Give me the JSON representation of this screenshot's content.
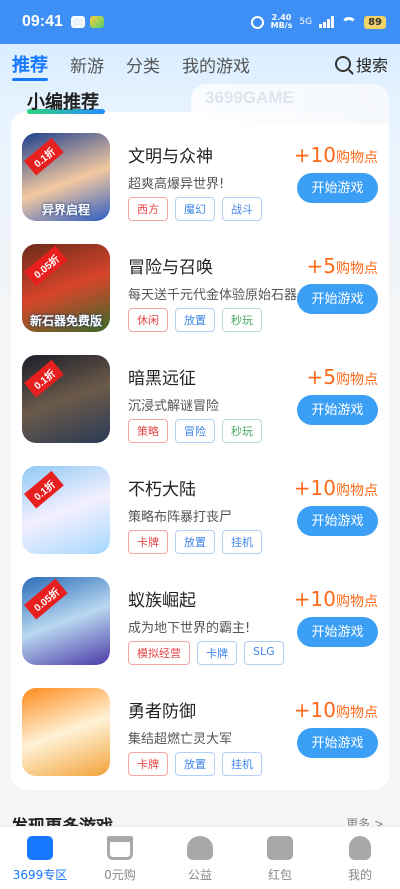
{
  "status": {
    "time": "09:41",
    "speed_top": "2.40",
    "speed_bottom": "MB/s",
    "network": "5G",
    "battery": "89"
  },
  "tabs": [
    {
      "label": "推荐",
      "active": true
    },
    {
      "label": "新游",
      "active": false
    },
    {
      "label": "分类",
      "active": false
    },
    {
      "label": "我的游戏",
      "active": false
    }
  ],
  "search_label": "搜索",
  "section": {
    "title": "小编推荐",
    "watermark": "3699GAME"
  },
  "games": [
    {
      "name": "文明与众神",
      "desc": "超爽高爆异世界!",
      "discount": "0.1折",
      "banner": "异界启程",
      "tags": [
        {
          "t": "西方",
          "c": "red"
        },
        {
          "t": "魔幻",
          "c": "blue"
        },
        {
          "t": "战斗",
          "c": "blue"
        }
      ],
      "points": "+10",
      "points_unit": "购物点",
      "button": "开始游戏"
    },
    {
      "name": "冒险与召唤",
      "desc": "每天送千元代金体验原始石器",
      "discount": "0.05折",
      "banner": "新石器免费版",
      "tags": [
        {
          "t": "休闲",
          "c": "red"
        },
        {
          "t": "放置",
          "c": "blue"
        },
        {
          "t": "秒玩",
          "c": "green"
        }
      ],
      "points": "+5",
      "points_unit": "购物点",
      "button": "开始游戏"
    },
    {
      "name": "暗黑远征",
      "desc": "沉浸式解谜冒险",
      "discount": "0.1折",
      "banner": "",
      "tags": [
        {
          "t": "策略",
          "c": "red"
        },
        {
          "t": "冒险",
          "c": "blue"
        },
        {
          "t": "秒玩",
          "c": "green"
        }
      ],
      "points": "+5",
      "points_unit": "购物点",
      "button": "开始游戏"
    },
    {
      "name": "不朽大陆",
      "desc": "策略布阵暴打丧尸",
      "discount": "0.1折",
      "banner": "",
      "tags": [
        {
          "t": "卡牌",
          "c": "red"
        },
        {
          "t": "放置",
          "c": "blue"
        },
        {
          "t": "挂机",
          "c": "blue"
        }
      ],
      "points": "+10",
      "points_unit": "购物点",
      "button": "开始游戏"
    },
    {
      "name": "蚁族崛起",
      "desc": "成为地下世界的霸主!",
      "discount": "0.05折",
      "banner": "",
      "tags": [
        {
          "t": "模拟经营",
          "c": "red"
        },
        {
          "t": "卡牌",
          "c": "blue"
        },
        {
          "t": "SLG",
          "c": "blue"
        }
      ],
      "points": "+10",
      "points_unit": "购物点",
      "button": "开始游戏"
    },
    {
      "name": "勇者防御",
      "desc": "集结超燃亡灵大军",
      "discount": "",
      "banner": "",
      "tags": [
        {
          "t": "卡牌",
          "c": "red"
        },
        {
          "t": "放置",
          "c": "blue"
        },
        {
          "t": "挂机",
          "c": "blue"
        }
      ],
      "points": "+10",
      "points_unit": "购物点",
      "button": "开始游戏"
    }
  ],
  "discover": {
    "title": "发现更多游戏",
    "more": "更多 >"
  },
  "bottom_nav": [
    {
      "label": "3699专区",
      "icon": "gamepad-icon",
      "active": true
    },
    {
      "label": "0元购",
      "icon": "cart-icon",
      "active": false
    },
    {
      "label": "公益",
      "icon": "heart-hands-icon",
      "active": false
    },
    {
      "label": "红包",
      "icon": "red-envelope-icon",
      "active": false
    },
    {
      "label": "我的",
      "icon": "person-icon",
      "active": false
    }
  ],
  "colors": {
    "accent": "#1677ff",
    "button": "#3ba0f5",
    "points": "#ff6a1a",
    "tag_red": "#e54545"
  }
}
